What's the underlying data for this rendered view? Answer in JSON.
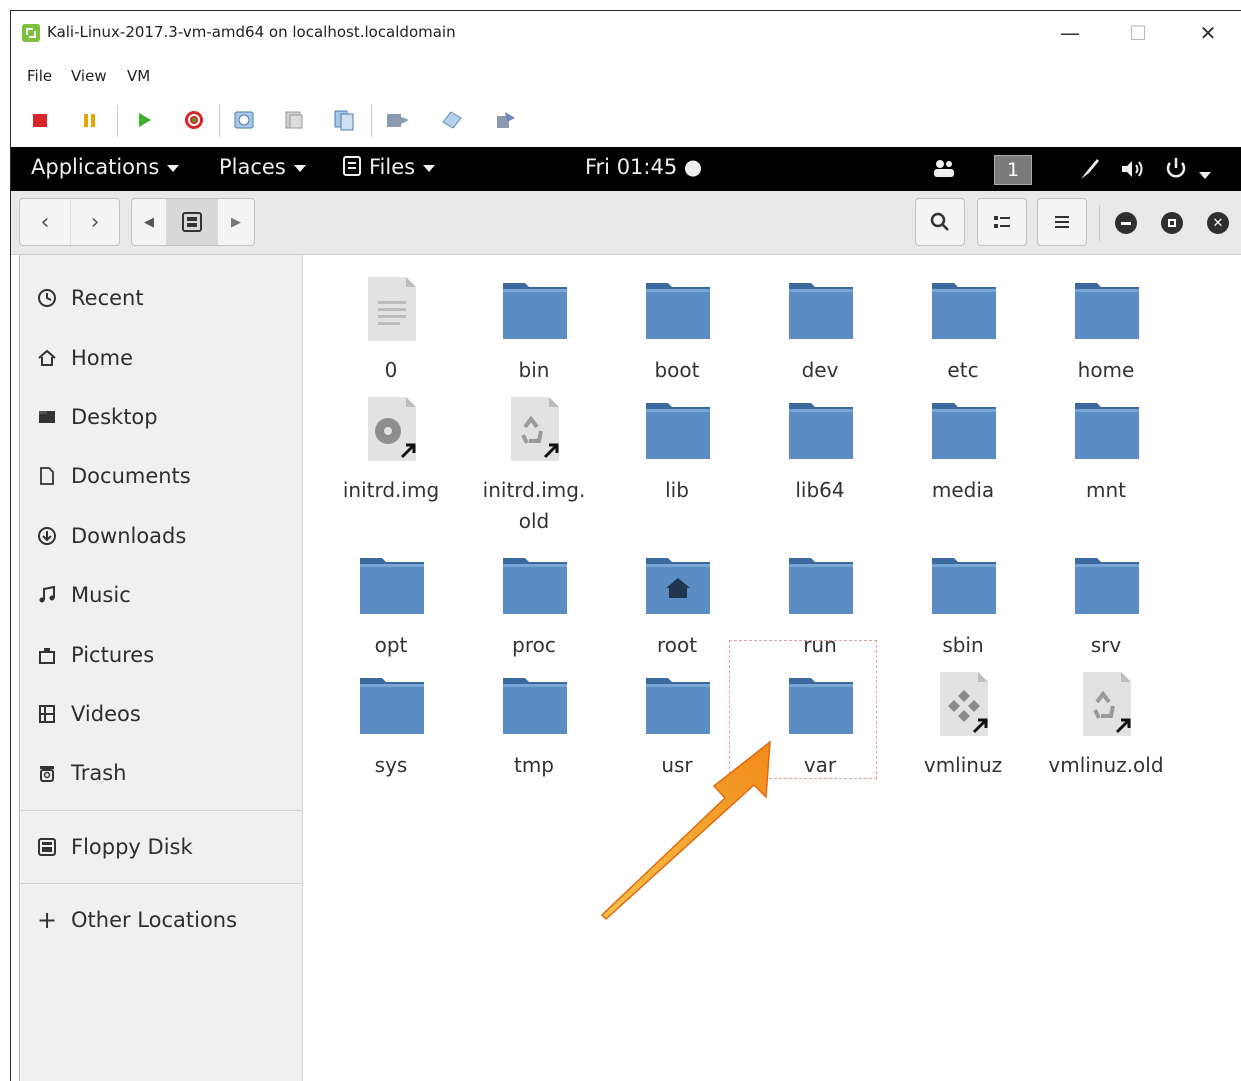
{
  "window": {
    "title": "Kali-Linux-2017.3-vm-amd64 on localhost.localdomain",
    "controls": {
      "minimize": "—",
      "maximize": "☐",
      "close": "✕"
    }
  },
  "menu": {
    "items": [
      "File",
      "View",
      "VM"
    ]
  },
  "vm_toolbar": {
    "buttons": [
      "stop-icon",
      "pause-icon",
      "play-icon",
      "reset-icon",
      "snapshot-icon",
      "revert-snapshot-icon",
      "manage-snapshots-icon",
      "send-keys-icon",
      "tools-icon",
      "settings-icon"
    ]
  },
  "topbar": {
    "applications": "Applications",
    "places": "Places",
    "files": "Files",
    "clock": "Fri 01:45 ●",
    "workspace": "1"
  },
  "sidebar": {
    "items": [
      {
        "label": "Recent",
        "icon": "clock-icon"
      },
      {
        "label": "Home",
        "icon": "home-icon"
      },
      {
        "label": "Desktop",
        "icon": "desktop-icon"
      },
      {
        "label": "Documents",
        "icon": "document-icon"
      },
      {
        "label": "Downloads",
        "icon": "download-icon"
      },
      {
        "label": "Music",
        "icon": "music-icon"
      },
      {
        "label": "Pictures",
        "icon": "pictures-icon"
      },
      {
        "label": "Videos",
        "icon": "videos-icon"
      },
      {
        "label": "Trash",
        "icon": "trash-icon"
      }
    ],
    "devices": [
      {
        "label": "Floppy Disk",
        "icon": "floppy-icon"
      }
    ],
    "other": {
      "label": "Other Locations",
      "icon": "plus-icon"
    }
  },
  "files": [
    {
      "name": "0",
      "type": "document"
    },
    {
      "name": "bin",
      "type": "folder"
    },
    {
      "name": "boot",
      "type": "folder"
    },
    {
      "name": "dev",
      "type": "folder"
    },
    {
      "name": "etc",
      "type": "folder"
    },
    {
      "name": "home",
      "type": "folder"
    },
    {
      "name": "initrd.img",
      "type": "disc-link"
    },
    {
      "name": "initrd.img.\nold",
      "type": "recycle-link"
    },
    {
      "name": "lib",
      "type": "folder"
    },
    {
      "name": "lib64",
      "type": "folder"
    },
    {
      "name": "media",
      "type": "folder"
    },
    {
      "name": "mnt",
      "type": "folder"
    },
    {
      "name": "opt",
      "type": "folder"
    },
    {
      "name": "proc",
      "type": "folder"
    },
    {
      "name": "root",
      "type": "home-folder"
    },
    {
      "name": "run",
      "type": "folder"
    },
    {
      "name": "sbin",
      "type": "folder"
    },
    {
      "name": "srv",
      "type": "folder"
    },
    {
      "name": "sys",
      "type": "folder"
    },
    {
      "name": "tmp",
      "type": "folder"
    },
    {
      "name": "usr",
      "type": "folder"
    },
    {
      "name": "var",
      "type": "folder"
    },
    {
      "name": "vmlinuz",
      "type": "exec-link"
    },
    {
      "name": "vmlinuz.old",
      "type": "recycle-link"
    }
  ],
  "colors": {
    "folder_body": "#5b8cc4",
    "folder_tab": "#3d6a9e",
    "arrow": "#f5a623",
    "topbar": "#000000"
  }
}
